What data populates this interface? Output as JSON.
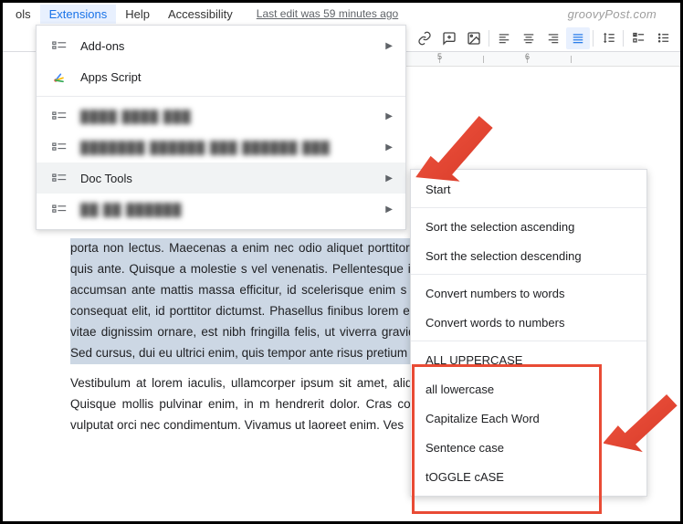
{
  "menubar": {
    "tools": "ols",
    "extensions": "Extensions",
    "help": "Help",
    "accessibility": "Accessibility",
    "edit_info": "Last edit was 59 minutes ago",
    "watermark": "groovyPost.com"
  },
  "ruler": {
    "n5": "5",
    "n6": "6"
  },
  "dropdown": {
    "addons": "Add-ons",
    "apps_script": "Apps Script",
    "blurred1": "████ ████ ███",
    "blurred2": "███████ ██████  ███ ██████ ███",
    "doc_tools": "Doc Tools",
    "blurred3": "██ ██ ██████"
  },
  "submenu": {
    "start": "Start",
    "sort_asc": "Sort the selection ascending",
    "sort_desc": "Sort the selection descending",
    "num_to_words": "Convert numbers to words",
    "words_to_num": "Convert words to numbers",
    "uppercase": "ALL UPPERCASE",
    "lowercase": "all lowercase",
    "cap_each": "Capitalize Each Word",
    "sentence": "Sentence case",
    "toggle": "tOGGLE cASE"
  },
  "doc": {
    "selected": "porta non lectus. Maecenas a enim nec odio aliquet porttitor aliquet vitae cursus id, blandit quis ante. Quisque a molestie s vel venenatis. Pellentesque iaculis aliquam felis, eu condim accumsan ante mattis massa efficitur, id scelerisque enim s tellus a ullamcorper. Etiam vel consequat elit, id porttitor dictumst. Phasellus finibus lorem et enim rhoncus, at viverra urna vitae dignissim ornare, est nibh fringilla felis, ut viverra gravida eget condimentum rhoncus. Sed cursus, dui eu ultrici enim, quis tempor ante risus pretium ex.",
    "rest": "Vestibulum at lorem iaculis, ullamcorper ipsum sit amet, aliqu vitae ultrices leo semper in. Quisque mollis pulvinar enim, in m hendrerit dolor. Cras congue enim quis neque viverra vulputat orci nec condimentum. Vivamus ut laoreet enim. Ves"
  }
}
